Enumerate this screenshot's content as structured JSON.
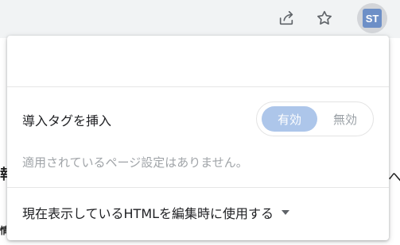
{
  "toolbar": {
    "share_icon": "share-icon",
    "star_icon": "star-icon",
    "avatar_initials": "ST"
  },
  "background": {
    "left_fragment_1": "報",
    "left_fragment_2": "情",
    "right_fragment": "へ"
  },
  "popup": {
    "header": "",
    "insert_tag_label": "導入タグを挿入",
    "toggle": {
      "on_label": "有効",
      "off_label": "無効",
      "selected": "有効"
    },
    "status_message": "適用されているページ設定はありません。",
    "mode_select": {
      "selected_label": "現在表示しているHTMLを編集時に使用する"
    }
  },
  "colors": {
    "toggle_active": "#adc6ea",
    "avatar_bg": "#6d8fc7",
    "muted_text": "#a0a4a8"
  }
}
